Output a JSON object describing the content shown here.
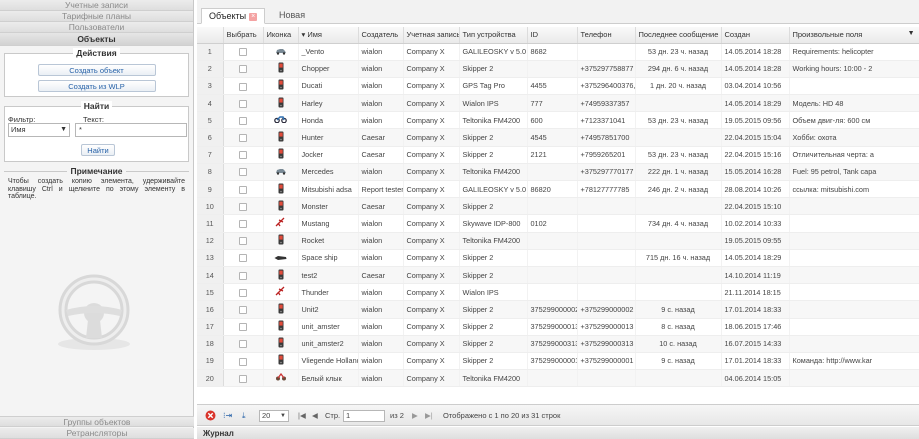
{
  "left_panel": {
    "menu_top": [
      "Учетные записи",
      "Тарифные планы",
      "Пользователи"
    ],
    "active_menu": "Объекты",
    "actions": {
      "title": "Действия",
      "create_object": "Создать объект",
      "create_from_wlp": "Создать из WLP"
    },
    "find": {
      "title": "Найти",
      "filter_label": "Фильтр:",
      "text_label": "Текст:",
      "filter_value": "Имя",
      "text_value": "*",
      "find_button": "Найти"
    },
    "note": {
      "title": "Примечание",
      "text": "Чтобы создать копию элемента, удерживайте клавишу Ctrl и щелкните по этому элементу в таблице."
    },
    "menu_bottom": [
      "Группы объектов",
      "Ретрансляторы"
    ]
  },
  "tabs": {
    "objects": "Объекты",
    "new": "Новая"
  },
  "grid": {
    "columns": [
      "",
      "Выбрать",
      "Иконка",
      "▾ Имя",
      "Создатель",
      "Учетная запись",
      "Тип устройства",
      "ID",
      "Телефон",
      "Последнее сообщение",
      "Создан",
      "Произвольные поля"
    ],
    "rows": [
      {
        "n": "1",
        "icon": "car",
        "name": "_Vento",
        "creator": "wialon",
        "account": "Company X",
        "device": "GALILEOSKY v 5.0",
        "id": "8682",
        "phone": "",
        "last": "53 дн. 23 ч. назад",
        "created": "14.05.2014 18:28",
        "custom": "Requirements: helicopter"
      },
      {
        "n": "2",
        "icon": "phone",
        "name": "Chopper",
        "creator": "wialon",
        "account": "Company X",
        "device": "Skipper 2",
        "id": "",
        "phone": "+375297758877",
        "last": "294 дн. 6 ч. назад",
        "created": "14.05.2014 18:28",
        "custom": "Working hours: 10:00 - 2"
      },
      {
        "n": "3",
        "icon": "phone",
        "name": "Ducati",
        "creator": "wialon",
        "account": "Company X",
        "device": "GPS Tag Pro",
        "id": "4455",
        "phone": "+375296400376,",
        "last": "1 дн. 20 ч. назад",
        "created": "03.04.2014 10:56",
        "custom": ""
      },
      {
        "n": "4",
        "icon": "phone",
        "name": "Harley",
        "creator": "wialon",
        "account": "Company X",
        "device": "Wialon IPS",
        "id": "777",
        "phone": "+74959337357",
        "last": "",
        "created": "14.05.2014 18:29",
        "custom": "Модель: HD 48"
      },
      {
        "n": "5",
        "icon": "moto",
        "name": "Honda",
        "creator": "wialon",
        "account": "Company X",
        "device": "Teltonika FM4200",
        "id": "600",
        "phone": "+7123371041",
        "last": "53 дн. 23 ч. назад",
        "created": "19.05.2015 09:56",
        "custom": "Объем двиг-ля: 600 см"
      },
      {
        "n": "6",
        "icon": "phone",
        "name": "Hunter",
        "creator": "Caesar",
        "account": "Company X",
        "device": "Skipper 2",
        "id": "4545",
        "phone": "+74957851700",
        "last": "",
        "created": "22.04.2015 15:04",
        "custom": "Хобби: охота"
      },
      {
        "n": "7",
        "icon": "phone",
        "name": "Jocker",
        "creator": "Caesar",
        "account": "Company X",
        "device": "Skipper 2",
        "id": "2121",
        "phone": "+7959265201",
        "last": "53 дн. 23 ч. назад",
        "created": "22.04.2015 15:16",
        "custom": "Отличительная черта: а"
      },
      {
        "n": "8",
        "icon": "car",
        "name": "Mercedes",
        "creator": "wialon",
        "account": "Company X",
        "device": "Teltonika FM4200",
        "id": "",
        "phone": "+375297770177",
        "last": "222 дн. 1 ч. назад",
        "created": "15.05.2014 16:28",
        "custom": "Fuel: 95 petrol, Tank capa"
      },
      {
        "n": "9",
        "icon": "phone",
        "name": "Mitsubishi adsa",
        "creator": "Report tester",
        "account": "Company X",
        "device": "GALILEOSKY v 5.0",
        "id": "86820",
        "phone": "+78127777785",
        "last": "246 дн. 2 ч. назад",
        "created": "28.08.2014 10:26",
        "custom": "ссылка: mitsubishi.com"
      },
      {
        "n": "10",
        "icon": "phone",
        "name": "Monster",
        "creator": "Caesar",
        "account": "Company X",
        "device": "Skipper 2",
        "id": "",
        "phone": "",
        "last": "",
        "created": "22.04.2015 15:10",
        "custom": ""
      },
      {
        "n": "11",
        "icon": "plane",
        "name": "Mustang",
        "creator": "wialon",
        "account": "Company X",
        "device": "Skywave IDP-800",
        "id": "0102",
        "phone": "",
        "last": "734 дн. 4 ч. назад",
        "created": "10.02.2014 10:33",
        "custom": ""
      },
      {
        "n": "12",
        "icon": "phone",
        "name": "Rocket",
        "creator": "wialon",
        "account": "Company X",
        "device": "Teltonika FM4200",
        "id": "",
        "phone": "",
        "last": "",
        "created": "19.05.2015 09:55",
        "custom": ""
      },
      {
        "n": "13",
        "icon": "ship",
        "name": "Space ship",
        "creator": "wialon",
        "account": "Company X",
        "device": "Skipper 2",
        "id": "",
        "phone": "",
        "last": "715 дн. 16 ч. назад",
        "created": "14.05.2014 18:29",
        "custom": ""
      },
      {
        "n": "14",
        "icon": "phone",
        "name": "test2",
        "creator": "Caesar",
        "account": "Company X",
        "device": "Skipper 2",
        "id": "",
        "phone": "",
        "last": "",
        "created": "14.10.2014 11:19",
        "custom": ""
      },
      {
        "n": "15",
        "icon": "plane",
        "name": "Thunder",
        "creator": "wialon",
        "account": "Company X",
        "device": "Wialon IPS",
        "id": "",
        "phone": "",
        "last": "",
        "created": "21.11.2014 18:15",
        "custom": ""
      },
      {
        "n": "16",
        "icon": "phone",
        "name": "Unit2",
        "creator": "wialon",
        "account": "Company X",
        "device": "Skipper 2",
        "id": "375299000002",
        "phone": "+375299000002",
        "last": "9 с. назад",
        "created": "17.01.2014 18:33",
        "custom": ""
      },
      {
        "n": "17",
        "icon": "phone",
        "name": "unit_amster",
        "creator": "wialon",
        "account": "Company X",
        "device": "Skipper 2",
        "id": "375299000013",
        "phone": "+375299000013",
        "last": "8 с. назад",
        "created": "18.06.2015 17:46",
        "custom": ""
      },
      {
        "n": "18",
        "icon": "phone",
        "name": "unit_amster2",
        "creator": "wialon",
        "account": "Company X",
        "device": "Skipper 2",
        "id": "375299000313",
        "phone": "+375299000313",
        "last": "10 с. назад",
        "created": "16.07.2015 14:33",
        "custom": ""
      },
      {
        "n": "19",
        "icon": "phone",
        "name": "Vliegende Hollander",
        "creator": "wialon",
        "account": "Company X",
        "device": "Skipper 2",
        "id": "375299000001",
        "phone": "+375299000001",
        "last": "9 с. назад",
        "created": "17.01.2014 18:33",
        "custom": "Команда: http://www.kar"
      },
      {
        "n": "20",
        "icon": "bike",
        "name": "Белый клык",
        "creator": "wialon",
        "account": "Company X",
        "device": "Teltonika FM4200",
        "id": "",
        "phone": "",
        "last": "",
        "created": "04.06.2014 15:05",
        "custom": ""
      }
    ]
  },
  "pager": {
    "page_size": "20",
    "page_label": "Стр.",
    "page_value": "1",
    "of_label": "из 2",
    "status": "Отображено с 1 по 20 из 31 строк"
  },
  "log_title": "Журнал",
  "colors": {
    "link_blue": "#2762a8",
    "close_red": "#f4a3a3",
    "stop_red": "#d9342b"
  }
}
